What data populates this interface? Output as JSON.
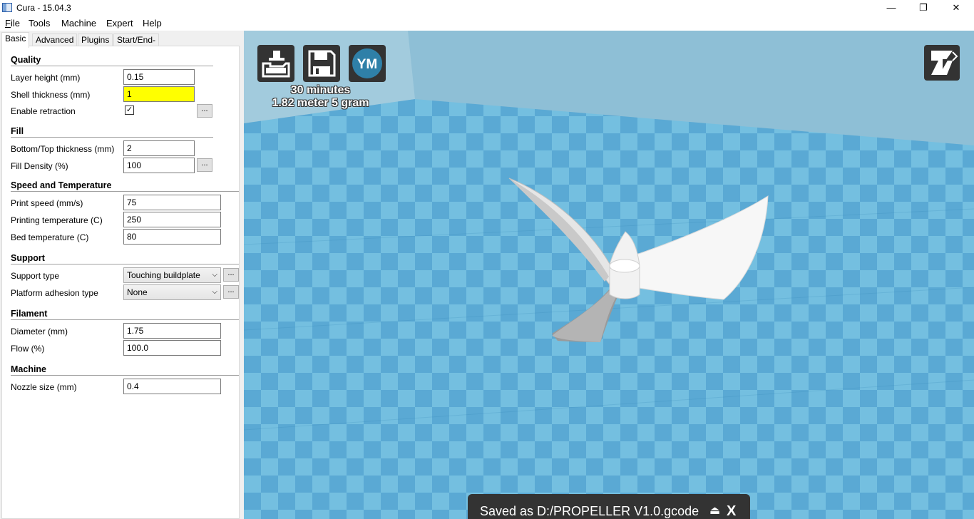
{
  "window": {
    "title": "Cura - 15.04.3",
    "minimize_icon": "—",
    "restore_icon": "❐",
    "close_icon": "✕"
  },
  "menu": {
    "file": {
      "u": "F",
      "rest": "ile"
    },
    "tools": "Tools",
    "machine": "Machine",
    "expert": "Expert",
    "help": "Help"
  },
  "tabs": [
    "Basic",
    "Advanced",
    "Plugins",
    "Start/End-GCode"
  ],
  "quality": {
    "title": "Quality",
    "layer_height_label": "Layer height (mm)",
    "layer_height": "0.15",
    "shell_thickness_label": "Shell thickness (mm)",
    "shell_thickness": "1",
    "retraction_label": "Enable retraction",
    "retraction_check": "✓"
  },
  "fill": {
    "title": "Fill",
    "bottom_top_label": "Bottom/Top thickness (mm)",
    "bottom_top": "2",
    "density_label": "Fill Density (%)",
    "density": "100"
  },
  "speed": {
    "title": "Speed and Temperature",
    "print_speed_label": "Print speed (mm/s)",
    "print_speed": "75",
    "print_temp_label": "Printing temperature (C)",
    "print_temp": "250",
    "bed_temp_label": "Bed temperature (C)",
    "bed_temp": "80"
  },
  "support": {
    "title": "Support",
    "type_label": "Support type",
    "type": "Touching buildplate",
    "adhesion_label": "Platform adhesion type",
    "adhesion": "None"
  },
  "filament": {
    "title": "Filament",
    "diameter_label": "Diameter (mm)",
    "diameter": "1.75",
    "flow_label": "Flow (%)",
    "flow": "100.0"
  },
  "machine": {
    "title": "Machine",
    "nozzle_label": "Nozzle size (mm)",
    "nozzle": "0.4"
  },
  "dots_label": "...",
  "viewport": {
    "ym_label": "YM",
    "print_time": "30 minutes",
    "print_material": "1.82 meter 5 gram",
    "saved_text": "Saved as D:/PROPELLER V1.0.gcode",
    "eject_icon": "⏏",
    "close_label": "X",
    "colors": {
      "background": "#8ebfd6",
      "tile_dark": "#5aa9d4",
      "tile_light": "#74bfe0",
      "model": "#f4f4f4"
    }
  }
}
